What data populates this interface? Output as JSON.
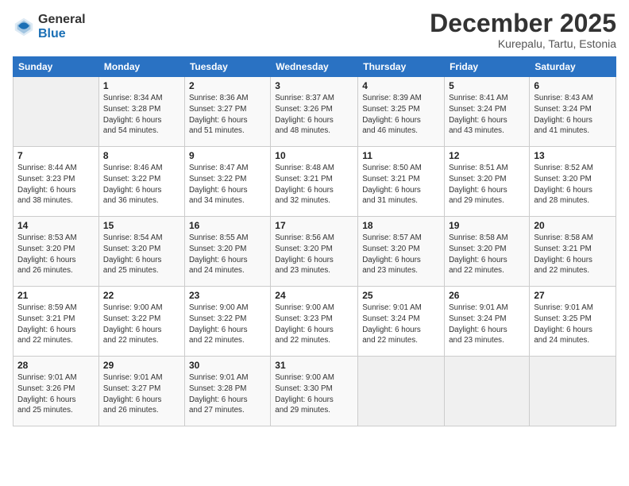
{
  "logo": {
    "general": "General",
    "blue": "Blue"
  },
  "header": {
    "title": "December 2025",
    "location": "Kurepalu, Tartu, Estonia"
  },
  "weekdays": [
    "Sunday",
    "Monday",
    "Tuesday",
    "Wednesday",
    "Thursday",
    "Friday",
    "Saturday"
  ],
  "weeks": [
    [
      {
        "day": "",
        "info": ""
      },
      {
        "day": "1",
        "info": "Sunrise: 8:34 AM\nSunset: 3:28 PM\nDaylight: 6 hours\nand 54 minutes."
      },
      {
        "day": "2",
        "info": "Sunrise: 8:36 AM\nSunset: 3:27 PM\nDaylight: 6 hours\nand 51 minutes."
      },
      {
        "day": "3",
        "info": "Sunrise: 8:37 AM\nSunset: 3:26 PM\nDaylight: 6 hours\nand 48 minutes."
      },
      {
        "day": "4",
        "info": "Sunrise: 8:39 AM\nSunset: 3:25 PM\nDaylight: 6 hours\nand 46 minutes."
      },
      {
        "day": "5",
        "info": "Sunrise: 8:41 AM\nSunset: 3:24 PM\nDaylight: 6 hours\nand 43 minutes."
      },
      {
        "day": "6",
        "info": "Sunrise: 8:43 AM\nSunset: 3:24 PM\nDaylight: 6 hours\nand 41 minutes."
      }
    ],
    [
      {
        "day": "7",
        "info": "Sunrise: 8:44 AM\nSunset: 3:23 PM\nDaylight: 6 hours\nand 38 minutes."
      },
      {
        "day": "8",
        "info": "Sunrise: 8:46 AM\nSunset: 3:22 PM\nDaylight: 6 hours\nand 36 minutes."
      },
      {
        "day": "9",
        "info": "Sunrise: 8:47 AM\nSunset: 3:22 PM\nDaylight: 6 hours\nand 34 minutes."
      },
      {
        "day": "10",
        "info": "Sunrise: 8:48 AM\nSunset: 3:21 PM\nDaylight: 6 hours\nand 32 minutes."
      },
      {
        "day": "11",
        "info": "Sunrise: 8:50 AM\nSunset: 3:21 PM\nDaylight: 6 hours\nand 31 minutes."
      },
      {
        "day": "12",
        "info": "Sunrise: 8:51 AM\nSunset: 3:20 PM\nDaylight: 6 hours\nand 29 minutes."
      },
      {
        "day": "13",
        "info": "Sunrise: 8:52 AM\nSunset: 3:20 PM\nDaylight: 6 hours\nand 28 minutes."
      }
    ],
    [
      {
        "day": "14",
        "info": "Sunrise: 8:53 AM\nSunset: 3:20 PM\nDaylight: 6 hours\nand 26 minutes."
      },
      {
        "day": "15",
        "info": "Sunrise: 8:54 AM\nSunset: 3:20 PM\nDaylight: 6 hours\nand 25 minutes."
      },
      {
        "day": "16",
        "info": "Sunrise: 8:55 AM\nSunset: 3:20 PM\nDaylight: 6 hours\nand 24 minutes."
      },
      {
        "day": "17",
        "info": "Sunrise: 8:56 AM\nSunset: 3:20 PM\nDaylight: 6 hours\nand 23 minutes."
      },
      {
        "day": "18",
        "info": "Sunrise: 8:57 AM\nSunset: 3:20 PM\nDaylight: 6 hours\nand 23 minutes."
      },
      {
        "day": "19",
        "info": "Sunrise: 8:58 AM\nSunset: 3:20 PM\nDaylight: 6 hours\nand 22 minutes."
      },
      {
        "day": "20",
        "info": "Sunrise: 8:58 AM\nSunset: 3:21 PM\nDaylight: 6 hours\nand 22 minutes."
      }
    ],
    [
      {
        "day": "21",
        "info": "Sunrise: 8:59 AM\nSunset: 3:21 PM\nDaylight: 6 hours\nand 22 minutes."
      },
      {
        "day": "22",
        "info": "Sunrise: 9:00 AM\nSunset: 3:22 PM\nDaylight: 6 hours\nand 22 minutes."
      },
      {
        "day": "23",
        "info": "Sunrise: 9:00 AM\nSunset: 3:22 PM\nDaylight: 6 hours\nand 22 minutes."
      },
      {
        "day": "24",
        "info": "Sunrise: 9:00 AM\nSunset: 3:23 PM\nDaylight: 6 hours\nand 22 minutes."
      },
      {
        "day": "25",
        "info": "Sunrise: 9:01 AM\nSunset: 3:24 PM\nDaylight: 6 hours\nand 22 minutes."
      },
      {
        "day": "26",
        "info": "Sunrise: 9:01 AM\nSunset: 3:24 PM\nDaylight: 6 hours\nand 23 minutes."
      },
      {
        "day": "27",
        "info": "Sunrise: 9:01 AM\nSunset: 3:25 PM\nDaylight: 6 hours\nand 24 minutes."
      }
    ],
    [
      {
        "day": "28",
        "info": "Sunrise: 9:01 AM\nSunset: 3:26 PM\nDaylight: 6 hours\nand 25 minutes."
      },
      {
        "day": "29",
        "info": "Sunrise: 9:01 AM\nSunset: 3:27 PM\nDaylight: 6 hours\nand 26 minutes."
      },
      {
        "day": "30",
        "info": "Sunrise: 9:01 AM\nSunset: 3:28 PM\nDaylight: 6 hours\nand 27 minutes."
      },
      {
        "day": "31",
        "info": "Sunrise: 9:00 AM\nSunset: 3:30 PM\nDaylight: 6 hours\nand 29 minutes."
      },
      {
        "day": "",
        "info": ""
      },
      {
        "day": "",
        "info": ""
      },
      {
        "day": "",
        "info": ""
      }
    ]
  ]
}
